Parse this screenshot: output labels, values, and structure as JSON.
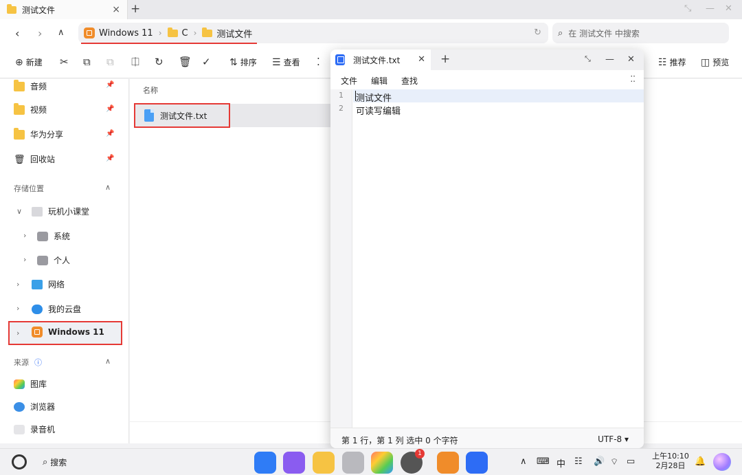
{
  "window": {
    "tab_label": "测试文件",
    "close_glyph": "×",
    "add_glyph": "+"
  },
  "address": {
    "segments": [
      "Windows 11",
      "C",
      "测试文件"
    ],
    "separator": "›",
    "search_placeholder": "在 测试文件 中搜索"
  },
  "toolbar": {
    "new_label": "新建",
    "sort_label": "排序",
    "view_label": "查看",
    "recommend_label": "推荐",
    "preview_label": "预览"
  },
  "sidebar": {
    "quick": [
      {
        "label": "音频",
        "icon": "folder-icon"
      },
      {
        "label": "视频",
        "icon": "folder-icon"
      },
      {
        "label": "华为分享",
        "icon": "folder-icon"
      },
      {
        "label": "回收站",
        "icon": "trash-icon"
      }
    ],
    "storage_header": "存储位置",
    "storage": [
      {
        "label": "玩机小课堂",
        "icon": "computer-icon"
      },
      {
        "label": "系统",
        "icon": "drive-icon"
      },
      {
        "label": "个人",
        "icon": "drive-icon"
      },
      {
        "label": "网络",
        "icon": "network-icon"
      },
      {
        "label": "我的云盘",
        "icon": "cloud-icon"
      },
      {
        "label": "Windows 11",
        "icon": "windows-vm-icon"
      }
    ],
    "source_header": "来源",
    "source": [
      {
        "label": "图库",
        "icon": "gallery-icon"
      },
      {
        "label": "浏览器",
        "icon": "browser-icon"
      },
      {
        "label": "录音机",
        "icon": "recorder-icon"
      }
    ]
  },
  "filelist": {
    "column_name": "名称",
    "files": [
      {
        "name": "测试文件.txt",
        "icon": "txt-file-icon"
      }
    ]
  },
  "notepad": {
    "tab_title": "测试文件.txt",
    "menus": [
      "文件",
      "编辑",
      "查找"
    ],
    "lines": [
      "测试文件",
      "可读写编辑"
    ],
    "line_numbers": [
      "1",
      "2"
    ],
    "status_position": "第 1 行，第 1 列  选中 0 个字符",
    "encoding": "UTF-8 ▾"
  },
  "taskbar": {
    "search_label": "搜索",
    "badge_count": "1",
    "time": "上午10:10",
    "date": "2月28日"
  },
  "colors": {
    "annotation_red": "#e53935",
    "folder_yellow": "#f6c343",
    "notepad_blue": "#2d6cf5"
  }
}
